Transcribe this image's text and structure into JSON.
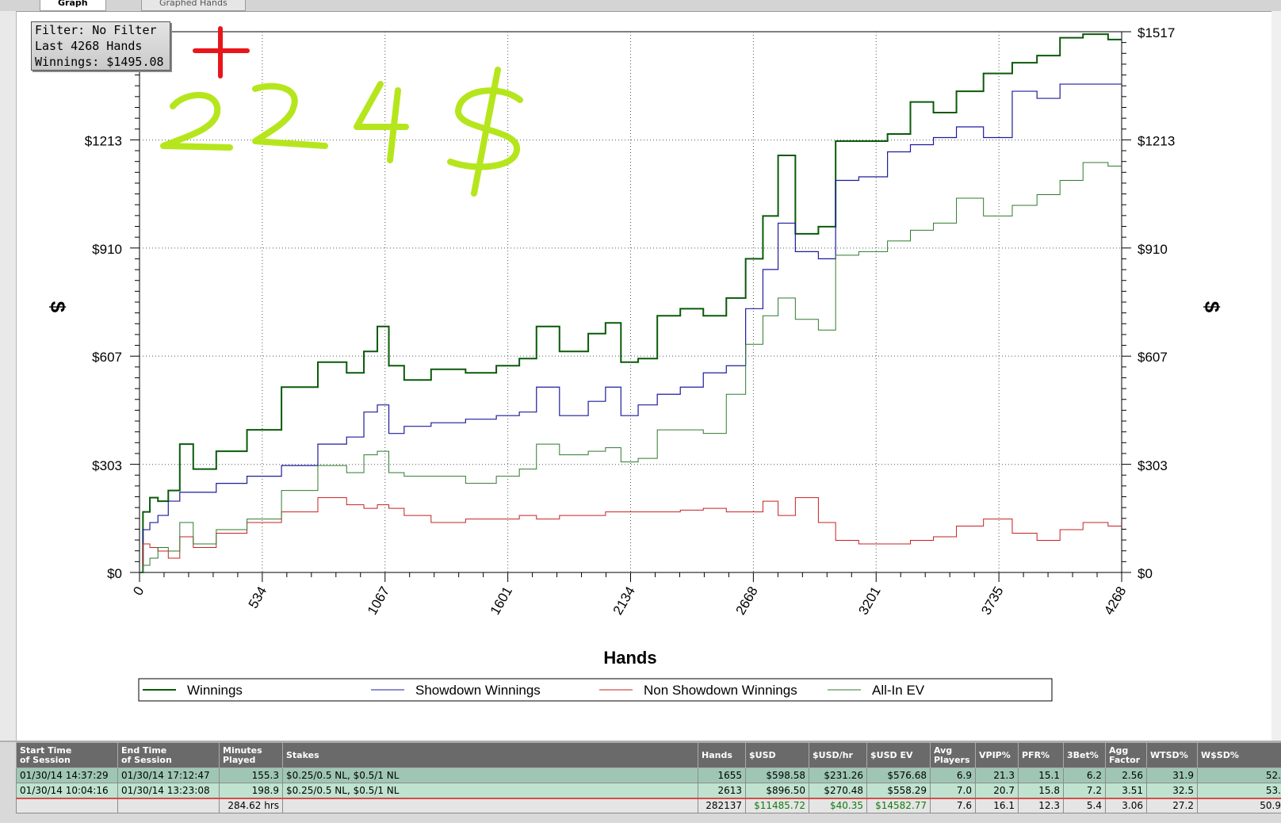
{
  "tabs": [
    {
      "label": "Graph",
      "active": true
    },
    {
      "label": "Graphed Hands",
      "active": false
    }
  ],
  "filter_box": {
    "filter": "Filter: No Filter",
    "last_hands": "Last  4268 Hands",
    "winnings": "Winnings: $1495.08"
  },
  "annotation": {
    "plus": "+",
    "amount": "224$",
    "plus_color": "#e8161b",
    "amount_color": "#b5e61d"
  },
  "chart_data": {
    "type": "line",
    "xlabel": "Hands",
    "ylabel": "$",
    "ylim": [
      0,
      1517
    ],
    "xlim": [
      0,
      4268
    ],
    "x_ticks": [
      "0",
      "534",
      "1067",
      "1601",
      "2134",
      "2668",
      "3201",
      "3735",
      "4268"
    ],
    "y_ticks": [
      "$0",
      "$303",
      "$607",
      "$910",
      "$1213",
      "$1517"
    ],
    "y_tick_values": [
      0,
      303,
      607,
      910,
      1213,
      1517
    ],
    "grid": true,
    "legend_position": "bottom",
    "x": [
      0,
      30,
      60,
      100,
      150,
      200,
      267,
      400,
      534,
      700,
      850,
      950,
      1000,
      1067,
      1100,
      1200,
      1334,
      1500,
      1601,
      1700,
      1750,
      1900,
      2000,
      2050,
      2134,
      2200,
      2300,
      2400,
      2500,
      2600,
      2668,
      2750,
      2800,
      2900,
      3000,
      3050,
      3201,
      3300,
      3400,
      3500,
      3600,
      3735,
      3850,
      3950,
      4050,
      4150,
      4268
    ],
    "series": [
      {
        "name": "Winnings",
        "color": "#0a5a0a",
        "values": [
          0,
          170,
          210,
          200,
          230,
          360,
          290,
          340,
          400,
          520,
          590,
          560,
          620,
          690,
          580,
          540,
          570,
          560,
          580,
          600,
          690,
          620,
          670,
          700,
          590,
          600,
          720,
          740,
          720,
          770,
          880,
          1000,
          1170,
          950,
          970,
          1210,
          1210,
          1230,
          1320,
          1290,
          1350,
          1400,
          1430,
          1450,
          1500,
          1510,
          1495
        ]
      },
      {
        "name": "Showdown Winnings",
        "color": "#1c1c9c",
        "values": [
          0,
          120,
          140,
          160,
          200,
          225,
          225,
          250,
          270,
          300,
          360,
          380,
          450,
          470,
          390,
          410,
          420,
          430,
          440,
          450,
          520,
          440,
          480,
          520,
          440,
          470,
          500,
          520,
          560,
          580,
          740,
          850,
          980,
          900,
          880,
          1100,
          1110,
          1180,
          1200,
          1220,
          1250,
          1220,
          1350,
          1330,
          1370,
          1370,
          1370
        ]
      },
      {
        "name": "Non Showdown Winnings",
        "color": "#c62020",
        "values": [
          0,
          80,
          70,
          60,
          40,
          100,
          70,
          110,
          140,
          170,
          210,
          190,
          180,
          190,
          180,
          160,
          140,
          150,
          150,
          160,
          150,
          160,
          160,
          170,
          170,
          170,
          170,
          175,
          180,
          170,
          170,
          200,
          160,
          210,
          140,
          90,
          80,
          80,
          90,
          100,
          130,
          150,
          110,
          90,
          120,
          140,
          130
        ]
      },
      {
        "name": "All-In EV",
        "color": "#2e7a2e",
        "values": [
          0,
          20,
          40,
          70,
          60,
          140,
          80,
          120,
          150,
          230,
          300,
          280,
          330,
          340,
          280,
          270,
          270,
          250,
          270,
          290,
          360,
          330,
          340,
          350,
          310,
          320,
          400,
          400,
          390,
          500,
          640,
          720,
          770,
          710,
          680,
          890,
          900,
          930,
          960,
          980,
          1050,
          1000,
          1030,
          1060,
          1100,
          1150,
          1140
        ]
      }
    ]
  },
  "sessions_table": {
    "columns": [
      "Start Time of Session",
      "End Time of Session",
      "Minutes Played",
      "Stakes",
      "Hands",
      "$USD",
      "$USD/hr",
      "$USD EV",
      "Avg Players",
      "VPIP%",
      "PFR%",
      "3Bet%",
      "Agg Factor",
      "WTSD%",
      "W$SD%"
    ],
    "columns_line1": [
      "Start Time",
      "End Time",
      "Minutes",
      "Stakes",
      "Hands",
      "$USD",
      "$USD/hr",
      "$USD EV",
      "Avg",
      "VPIP%",
      "PFR%",
      "3Bet%",
      "Agg",
      "WTSD%",
      "W$SD%"
    ],
    "columns_line2": [
      "of Session",
      "of Session",
      "Played",
      "",
      "",
      "",
      "",
      "",
      "Players",
      "",
      "",
      "",
      "Factor",
      "",
      ""
    ],
    "rows": [
      [
        "01/30/14 14:37:29",
        "01/30/14 17:12:47",
        "155.3",
        "$0.25/0.5 NL, $0.5/1 NL",
        "1655",
        "$598.58",
        "$231.26",
        "$576.68",
        "6.9",
        "21.3",
        "15.1",
        "6.2",
        "2.56",
        "31.9",
        "52."
      ],
      [
        "01/30/14 10:04:16",
        "01/30/14 13:23:08",
        "198.9",
        "$0.25/0.5 NL, $0.5/1 NL",
        "2613",
        "$896.50",
        "$270.48",
        "$558.29",
        "7.0",
        "20.7",
        "15.8",
        "7.2",
        "3.51",
        "32.5",
        "53."
      ]
    ],
    "totals": [
      "",
      "",
      "284.62 hrs",
      "",
      "282137",
      "$11485.72",
      "$40.35",
      "$14582.77",
      "7.6",
      "16.1",
      "12.3",
      "5.4",
      "3.06",
      "27.2",
      "50.9"
    ]
  }
}
